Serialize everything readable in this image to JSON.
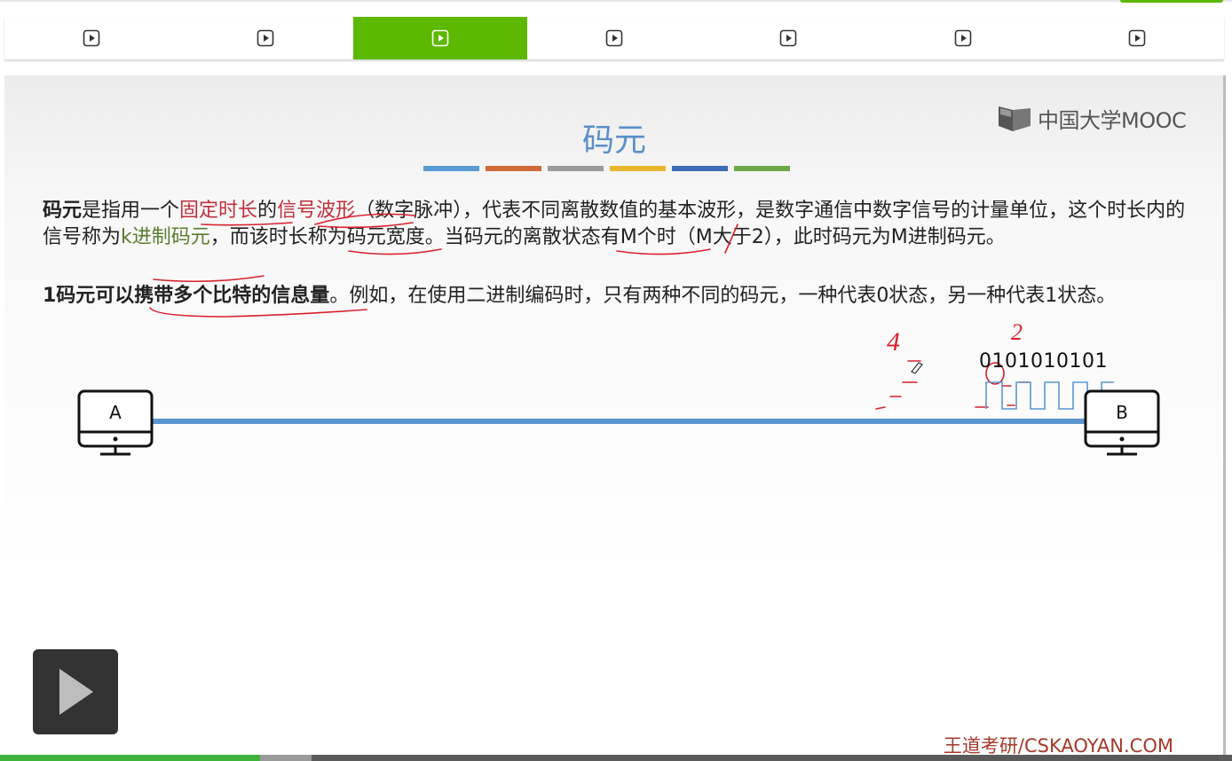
{
  "tabs": [
    {
      "icon": "play-square-icon",
      "active": false
    },
    {
      "icon": "play-square-icon",
      "active": false
    },
    {
      "icon": "play-square-icon",
      "active": true
    },
    {
      "icon": "play-square-icon",
      "active": false
    },
    {
      "icon": "play-square-icon",
      "active": false
    },
    {
      "icon": "play-square-icon",
      "active": false
    },
    {
      "icon": "play-square-icon",
      "active": false
    }
  ],
  "colors": {
    "accent_green": "#5cb800",
    "title_blue": "#5a8fc8",
    "bar_colors": [
      "#5b9bd5",
      "#d06a3a",
      "#9a9a9a",
      "#e8b62d",
      "#3e6cb4",
      "#6fa84a"
    ],
    "link_line": "#5b97cf"
  },
  "slide": {
    "title": "码元",
    "logo": "中国大学MOOC",
    "paragraph1": {
      "s1": "码元",
      "s2": "是指用一个",
      "s3": "固定时长",
      "s4": "的",
      "s5": "信号波形",
      "s6": "（数字脉冲），代表不同离散数值的基本波形，是数字通信中数字信号的计量单位，这个时长内的信号称为",
      "s7": "k进制码元",
      "s8": "，而该时长称为",
      "s9": "码元宽度",
      "s10": "。当码元的离散状态有M个时（M大于2），此时码元为",
      "s11": "M进制码元",
      "s12": "。"
    },
    "paragraph2": {
      "s1": "1码元可以携带多个比特的信息量",
      "s2": "。例如，在使用二进制编码时，只有两种不同的码元，一种代表0状态，另一种代表1状态。"
    },
    "device_a": "A",
    "device_b": "B",
    "bits": "0101010101",
    "handwriting": {
      "left": "4",
      "right": "2"
    },
    "watermark": "王道考研/CSKAOYAN.COM"
  },
  "player": {
    "progress_played_fraction": 0.211
  }
}
